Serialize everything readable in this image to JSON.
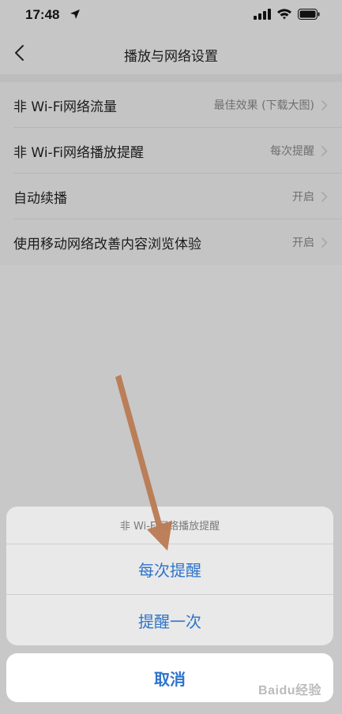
{
  "status_bar": {
    "time": "17:48"
  },
  "nav": {
    "title": "播放与网络设置"
  },
  "settings": [
    {
      "label": "非 Wi-Fi网络流量",
      "value": "最佳效果 (下载大图)"
    },
    {
      "label": "非 Wi-Fi网络播放提醒",
      "value": "每次提醒"
    },
    {
      "label": "自动续播",
      "value": "开启"
    },
    {
      "label": "使用移动网络改善内容浏览体验",
      "value": "开启"
    }
  ],
  "action_sheet": {
    "title": "非 Wi-Fi网络播放提醒",
    "options": [
      "每次提醒",
      "提醒一次"
    ],
    "cancel": "取消"
  },
  "watermark": {
    "text": "Baidu经验"
  },
  "colors": {
    "accent": "#2f74c9",
    "annotation_arrow": "#b97a52"
  }
}
